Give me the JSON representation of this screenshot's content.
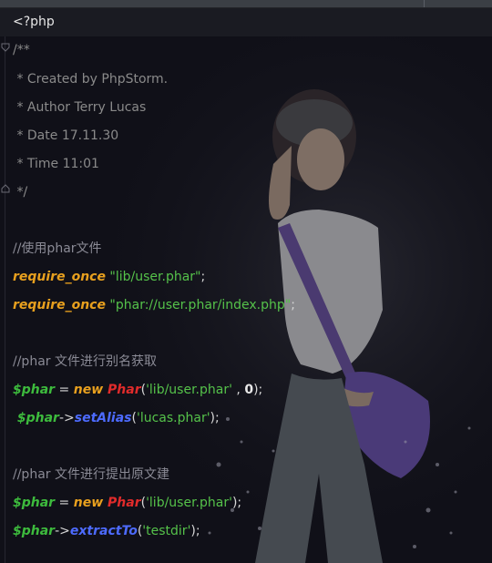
{
  "header": {
    "title": "<?php"
  },
  "code": {
    "doc": [
      "/**",
      " * Created by PhpStorm.",
      " * Author Terry Lucas",
      " * Date 17.11.30",
      " * Time 11:01",
      " */"
    ],
    "comment1": "//使用phar文件",
    "line_req1": {
      "kw": "require_once",
      "str": " \"lib/user.phar\"",
      "end": ";"
    },
    "line_req2": {
      "kw": "require_once",
      "str": " \"phar://user.phar/index.php\"",
      "end": ";"
    },
    "comment2": "//phar 文件进行别名获取",
    "line_new1": {
      "var": "$phar",
      "eq": " = ",
      "kw": "new",
      "cls": " Phar",
      "open": "(",
      "str": "'lib/user.phar'",
      "comma": " , ",
      "num": "0",
      "close": ");"
    },
    "line_alias": {
      "var": " $phar",
      "arrow": "->",
      "meth": "setAlias",
      "open": "(",
      "str": "'lucas.phar'",
      "close": ");"
    },
    "comment3": "//phar 文件进行提出原文建",
    "line_new2": {
      "var": "$phar",
      "eq": " = ",
      "kw": "new",
      "cls": " Phar",
      "open": "(",
      "str": "'lib/user.phar'",
      "close": ");"
    },
    "line_extract": {
      "var": "$phar",
      "arrow": "->",
      "meth": "extractTo",
      "open": "(",
      "str": "'testdir'",
      "close": ");"
    }
  },
  "colors": {
    "keyword": "#e8a01e",
    "string": "#55c24a",
    "variable": "#3dbb3d",
    "class": "#e02b2b",
    "method": "#4d6bff",
    "comment": "#8a8a95"
  },
  "background_image": "photo-woman-water-splash"
}
